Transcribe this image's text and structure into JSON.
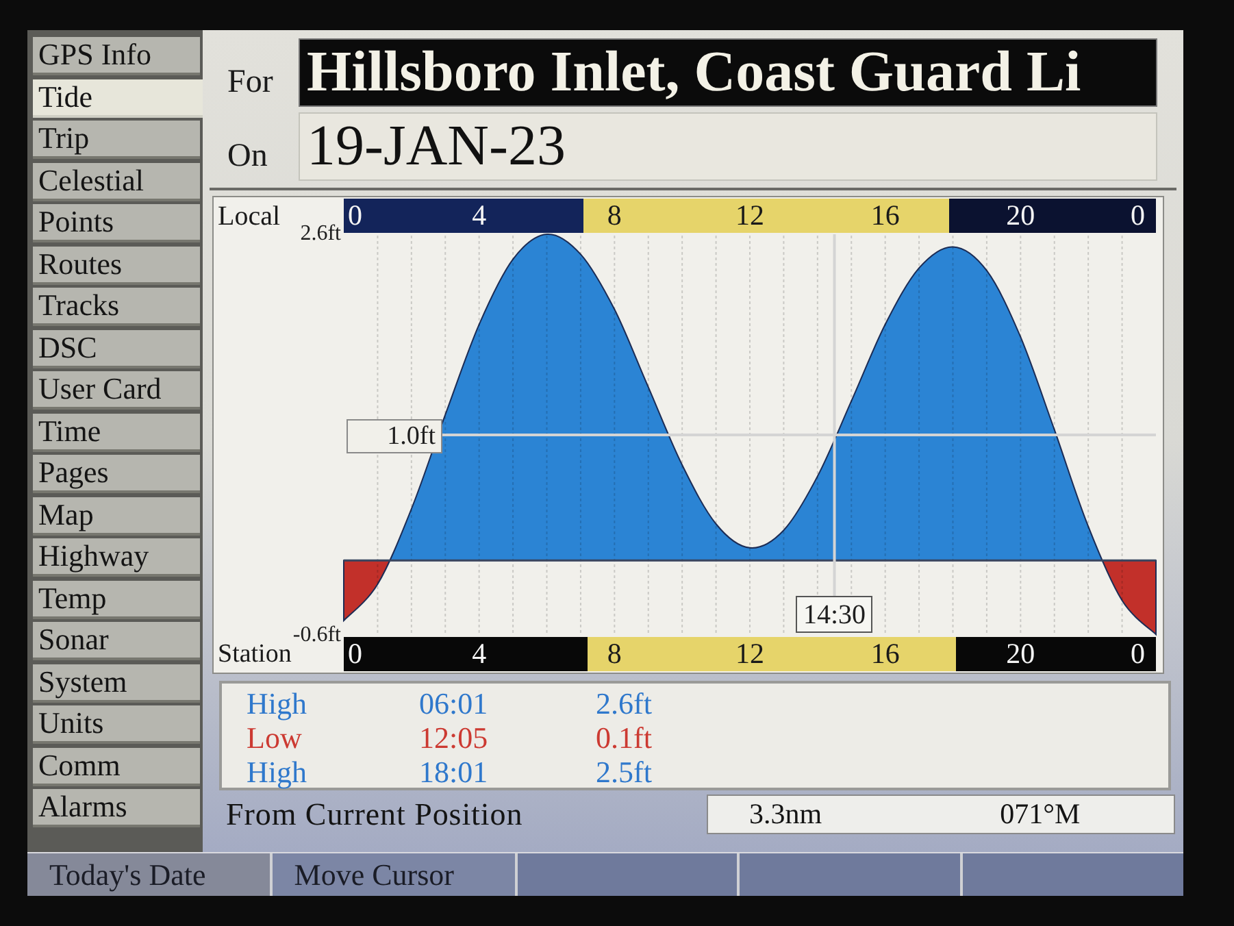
{
  "sidebar": {
    "items": [
      {
        "label": "GPS Info",
        "selected": false
      },
      {
        "label": "Tide",
        "selected": true
      },
      {
        "label": "Trip",
        "selected": false
      },
      {
        "label": "Celestial",
        "selected": false
      },
      {
        "label": "Points",
        "selected": false
      },
      {
        "label": "Routes",
        "selected": false
      },
      {
        "label": "Tracks",
        "selected": false
      },
      {
        "label": "DSC",
        "selected": false
      },
      {
        "label": "User Card",
        "selected": false
      },
      {
        "label": "Time",
        "selected": false
      },
      {
        "label": "Pages",
        "selected": false
      },
      {
        "label": "Map",
        "selected": false
      },
      {
        "label": "Highway",
        "selected": false
      },
      {
        "label": "Temp",
        "selected": false
      },
      {
        "label": "Sonar",
        "selected": false
      },
      {
        "label": "System",
        "selected": false
      },
      {
        "label": "Units",
        "selected": false
      },
      {
        "label": "Comm",
        "selected": false
      },
      {
        "label": "Alarms",
        "selected": false
      }
    ]
  },
  "fields": [
    {
      "label": "For",
      "value": "Hillsboro Inlet, Coast Guard Li",
      "selected": true
    },
    {
      "label": "On",
      "value": "19-JAN-23",
      "selected": false
    }
  ],
  "tide_graph": {
    "top_axis": {
      "label": "Local",
      "day_start": {
        "level": 0.295
      },
      "day_end": {
        "level": 0.745
      },
      "end_label": "0"
    },
    "chart_data": {
      "type": "area",
      "x": [
        0,
        1,
        2,
        3,
        4,
        5,
        6,
        7,
        8,
        9,
        10,
        11,
        12,
        13,
        14,
        15,
        16,
        17,
        18,
        19,
        20,
        21,
        22,
        23,
        24
      ],
      "values": [
        -0.48,
        -0.19,
        0.41,
        1.16,
        1.88,
        2.4,
        2.6,
        2.44,
        2.0,
        1.38,
        0.76,
        0.29,
        0.1,
        0.24,
        0.67,
        1.27,
        1.88,
        2.33,
        2.5,
        2.31,
        1.78,
        1.04,
        0.27,
        -0.32,
        -0.59
      ],
      "xlim": [
        0,
        24
      ],
      "ylim": [
        -0.6,
        2.6
      ],
      "xticks": [
        {
          "value": 0,
          "label": "0"
        },
        {
          "value": 4,
          "label": "4"
        },
        {
          "value": 8,
          "label": "8"
        },
        {
          "value": 12,
          "label": "12"
        },
        {
          "value": 16,
          "label": "16"
        },
        {
          "value": 20,
          "label": "20"
        }
      ],
      "yticks": [
        {
          "value": 2.6,
          "label": "2.6ft"
        },
        {
          "value": -0.6,
          "label": "-0.6ft"
        }
      ],
      "grid": true,
      "ref_lines": [
        {
          "axis": "y",
          "value": 0
        },
        {
          "axis": "x",
          "value": 14.5,
          "label": "14:30"
        },
        {
          "axis": "y",
          "value": 1.0,
          "label": "1.0ft"
        }
      ]
    },
    "bottom_axis": {
      "label": "Station",
      "day_start": {
        "level": 0.3
      },
      "day_end": {
        "level": 0.754
      },
      "ticks": [
        "0",
        "4",
        "8",
        "12",
        "16",
        "20",
        "0"
      ]
    }
  },
  "tides": [
    {
      "kind": "high",
      "type": "High",
      "time": "06:01",
      "height": "2.6ft"
    },
    {
      "kind": "low",
      "type": "Low",
      "time": "12:05",
      "height": "0.1ft"
    },
    {
      "kind": "high",
      "type": "High",
      "time": "18:01",
      "height": "2.5ft"
    }
  ],
  "position": {
    "label": "From Current Position",
    "distance": "3.3nm",
    "bearing": "071°M"
  },
  "softkeys": [
    {
      "kind": "key",
      "label": "Today's Date"
    },
    {
      "kind": "key",
      "label": "Move Cursor"
    },
    {
      "kind": "blank"
    },
    {
      "kind": "blank"
    },
    {
      "kind": "blank"
    }
  ]
}
